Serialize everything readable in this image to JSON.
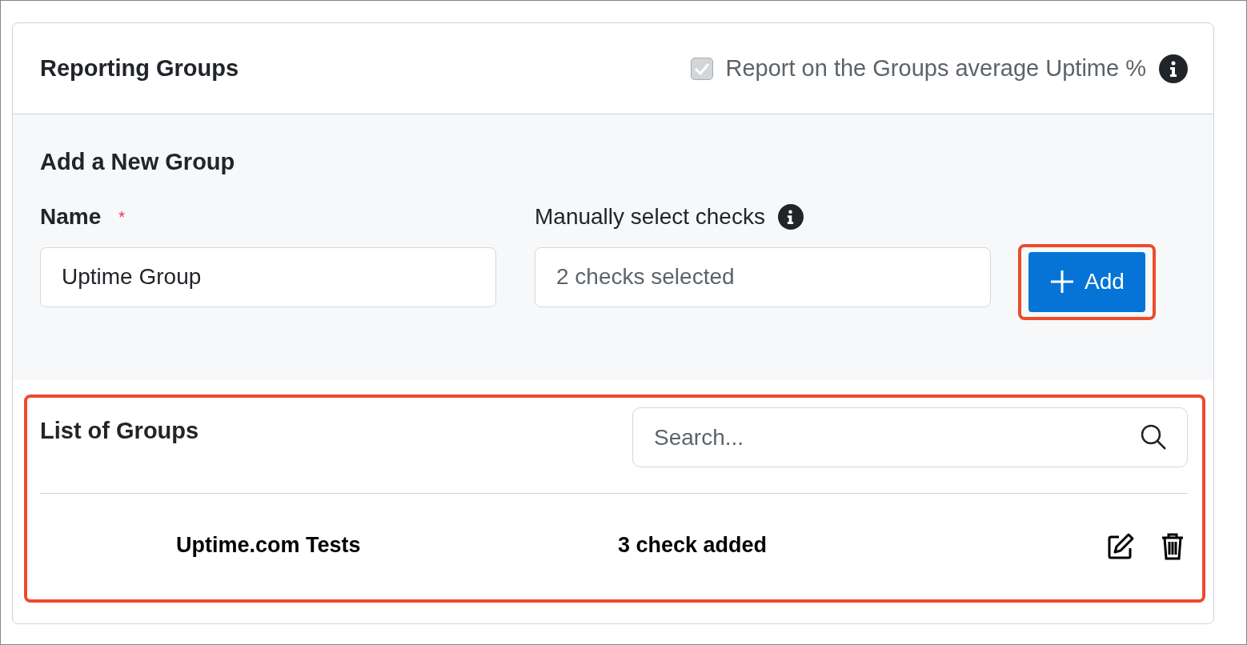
{
  "card": {
    "title": "Reporting Groups",
    "average_option": {
      "label": "Report on the Groups average Uptime %",
      "checked": true,
      "disabled": true
    }
  },
  "new_group": {
    "heading": "Add a New Group",
    "name_field": {
      "label": "Name",
      "required": true,
      "required_mark": "*",
      "value": "Uptime Group"
    },
    "checks_field": {
      "label": "Manually select checks",
      "placeholder": "2 checks selected"
    },
    "add_button": {
      "label": "Add",
      "highlighted": true
    }
  },
  "group_list": {
    "heading": "List of Groups",
    "highlighted": true,
    "search": {
      "placeholder": "Search..."
    },
    "rows": [
      {
        "name": "Uptime.com Tests",
        "checks": "3 check added"
      }
    ]
  }
}
